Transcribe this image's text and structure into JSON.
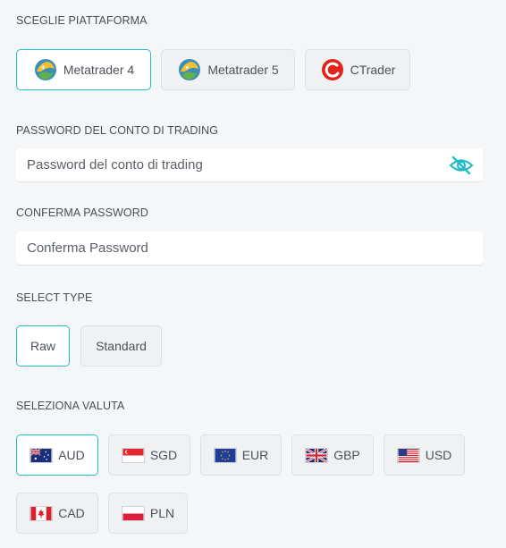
{
  "platform": {
    "label": "SCEGLIE PIATTAFORMA",
    "options": [
      {
        "label": "Metatrader 4",
        "icon": "metatrader-icon",
        "selected": true
      },
      {
        "label": "Metatrader 5",
        "icon": "metatrader-icon",
        "selected": false
      },
      {
        "label": "CTrader",
        "icon": "ctrader-icon",
        "selected": false
      }
    ]
  },
  "password": {
    "label": "PASSWORD DEL CONTO DI TRADING",
    "placeholder": "Password del conto di trading",
    "toggle_icon": "eye-slash-icon"
  },
  "confirm": {
    "label": "CONFERMA PASSWORD",
    "placeholder": "Conferma Password"
  },
  "type": {
    "label": "SELECT TYPE",
    "options": [
      {
        "label": "Raw",
        "selected": true
      },
      {
        "label": "Standard",
        "selected": false
      }
    ]
  },
  "currency": {
    "label": "SELEZIONA VALUTA",
    "options": [
      {
        "label": "AUD",
        "icon": "australia-flag-icon",
        "selected": true
      },
      {
        "label": "SGD",
        "icon": "singapore-flag-icon",
        "selected": false
      },
      {
        "label": "EUR",
        "icon": "eu-flag-icon",
        "selected": false
      },
      {
        "label": "GBP",
        "icon": "uk-flag-icon",
        "selected": false
      },
      {
        "label": "USD",
        "icon": "us-flag-icon",
        "selected": false
      },
      {
        "label": "CAD",
        "icon": "canada-flag-icon",
        "selected": false
      },
      {
        "label": "PLN",
        "icon": "poland-flag-icon",
        "selected": false
      }
    ]
  },
  "colors": {
    "accent": "#22bcc6",
    "background": "#f4f6f8"
  }
}
